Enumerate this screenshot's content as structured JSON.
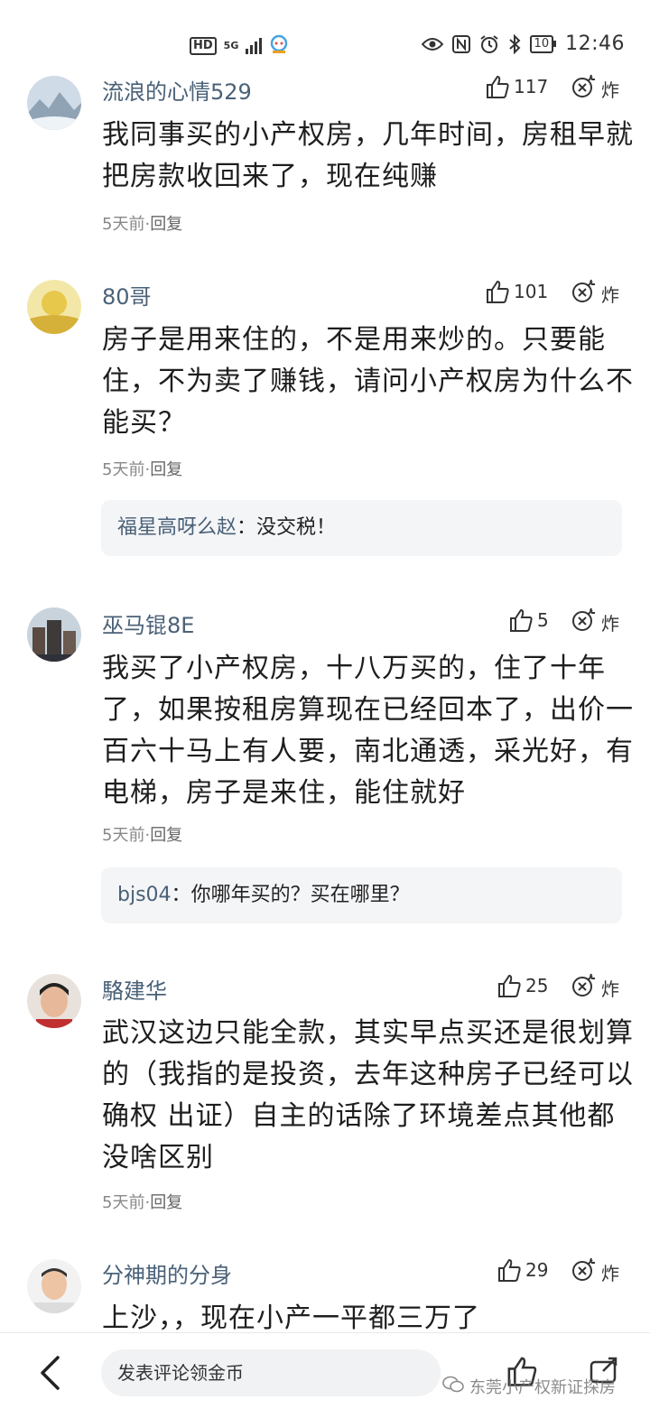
{
  "status_bar": {
    "hd": "HD",
    "network": "5G",
    "battery": "10",
    "time": "12:46"
  },
  "comments": [
    {
      "user": "流浪的心情529",
      "likes": "117",
      "fire": "炸",
      "text": "我同事买的小产权房，几年时间，房租早就把房款收回来了，现在纯赚",
      "time": "5天前",
      "sep": "·",
      "reply": "回复"
    },
    {
      "user": "80哥",
      "likes": "101",
      "fire": "炸",
      "text": "房子是用来住的，不是用来炒的。只要能住，不为卖了赚钱，请问小产权房为什么不能买？",
      "time": "5天前",
      "sep": "·",
      "reply": "回复",
      "sub_reply": {
        "user": "福星高呀么赵",
        "colon": "：",
        "text": "没交税！"
      }
    },
    {
      "user": "巫马锟8E",
      "likes": "5",
      "fire": "炸",
      "text": "我买了小产权房，十八万买的，住了十年了，如果按租房算现在已经回本了，出价一百六十马上有人要，南北通透，采光好，有电梯，房子是来住，能住就好",
      "time": "5天前",
      "sep": "·",
      "reply": "回复",
      "sub_reply": {
        "user": "bjs04",
        "colon": "：",
        "text": "你哪年买的？买在哪里？"
      }
    },
    {
      "user": "駱建华",
      "likes": "25",
      "fire": "炸",
      "text": "武汉这边只能全款，其实早点买还是很划算的（我指的是投资，去年这种房子已经可以确权 出证）自主的话除了环境差点其他都没啥区别",
      "time": "5天前",
      "sep": "·",
      "reply": "回复"
    },
    {
      "user": "分神期的分身",
      "likes": "29",
      "fire": "炸",
      "text": "上沙，，现在小产一平都三万了"
    }
  ],
  "bottom_bar": {
    "input_placeholder": "发表评论领金币",
    "watermark": "东莞小产权新证探房"
  },
  "icons": {
    "back": "chevron-left-icon",
    "like": "thumbs-up-icon",
    "fire": "bomb-icon",
    "eye": "eye-icon",
    "nfc": "nfc-icon",
    "alarm": "alarm-icon",
    "bluetooth": "bluetooth-icon"
  },
  "colors": {
    "username": "#4a6178",
    "reply_bg": "#f4f5f7",
    "meta": "#888888"
  }
}
